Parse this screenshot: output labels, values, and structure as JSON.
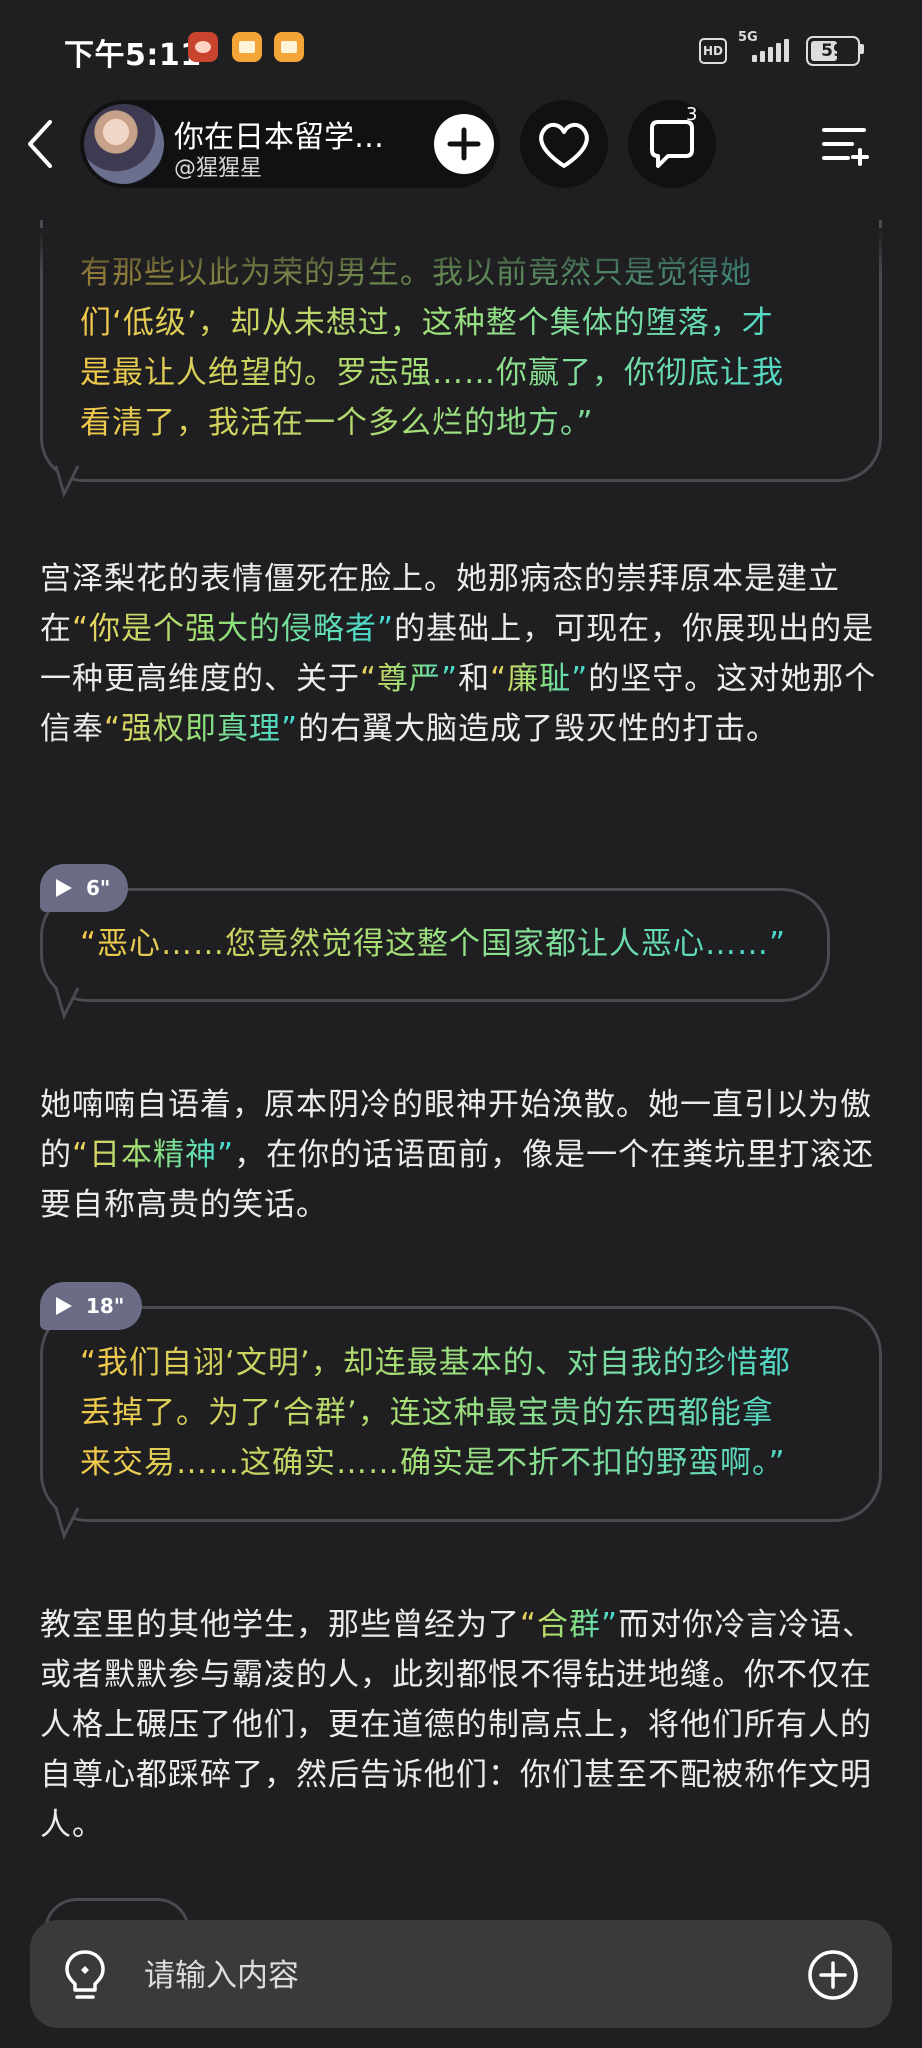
{
  "status_bar": {
    "time": "下午5:11",
    "hd": "HD",
    "network": "5G",
    "battery": "59"
  },
  "header": {
    "title": "你在日本留学…",
    "handle": "@猩猩星",
    "comments_count": "3"
  },
  "messages": {
    "quote1": {
      "lines": [
        "有那些以此为荣的男生。我以前竟然只是觉得她",
        "们‘低级’，却从未想过，这种整个集体的堕落，才",
        "是最让人绝望的。罗志强……你赢了，你彻底让我",
        "看清了，我活在一个多么烂的地方。”"
      ]
    },
    "narr1": {
      "p1": "宫泽梨花的表情僵死在脸上。她那病态的崇拜原本是建立在",
      "h1": "“你是个强大的侵略者”",
      "p2": "的基础上，可现在，你展现出的是一种更高维度的、关于",
      "h2": "“尊严”",
      "p3": "和",
      "h3": "“廉耻”",
      "p4": "的坚守。这对她那个信奉",
      "h4": "“强权即真理”",
      "p5": "的右翼大脑造成了毁灭性的打击。"
    },
    "quote2": {
      "duration": "6\"",
      "text": "“恶心……您竟然觉得这整个国家都让人恶心……”"
    },
    "narr2": {
      "p1": "她喃喃自语着，原本阴冷的眼神开始涣散。她一直引以为傲的",
      "h1": "“日本精神”",
      "p2": "，在你的话语面前，像是一个在粪坑里打滚还要自称高贵的笑话。"
    },
    "quote3": {
      "duration": "18\"",
      "lines": [
        "“我们自诩‘文明’，却连最基本的、对自我的珍惜都",
        "丢掉了。为了‘合群’，连这种最宝贵的东西都能拿",
        "来交易……这确实……确实是不折不扣的野蛮啊。”"
      ]
    },
    "narr3": {
      "p1": "教室里的其他学生，那些曾经为了",
      "h1": "“合群”",
      "p2": "而对你冷言冷语、或者默默参与霸凌的人，此刻都恨不得钻进地缝。你不仅在人格上碾压了他们，更在道德的制高点上，将他们所有人的自尊心都踩碎了，然后告诉他们：你们甚至不配被称作文明人。"
    }
  },
  "input": {
    "placeholder": "请输入内容"
  },
  "icons": {
    "back": "chevron-left-icon",
    "plus": "plus-icon",
    "like": "heart-icon",
    "comment": "chat-bubble-icon",
    "menu": "menu-lines-icon",
    "hint": "lightbulb-icon",
    "add": "circle-plus-icon",
    "play": "play-icon"
  }
}
